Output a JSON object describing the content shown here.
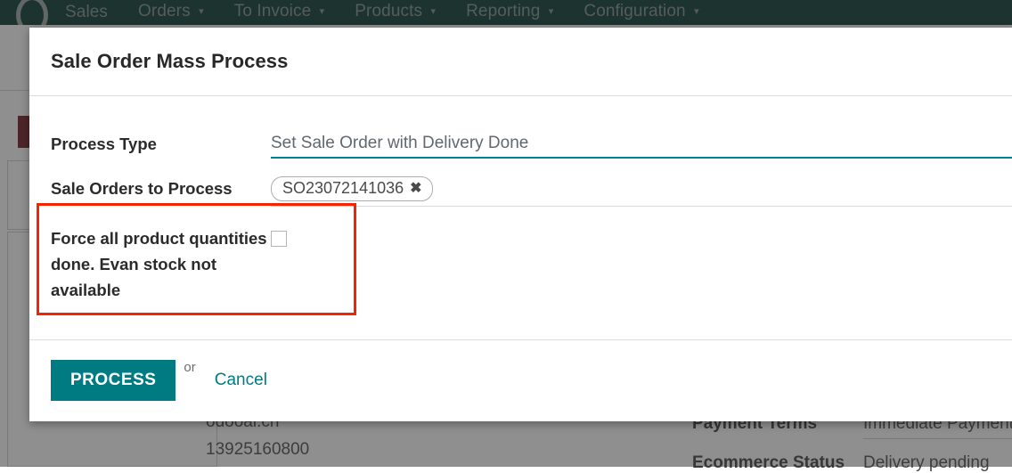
{
  "navbar": {
    "logo_icon": "odoo-o-logo-icon",
    "menu_items": [
      {
        "label": "Sales",
        "has_caret": false
      },
      {
        "label": "Orders",
        "has_caret": true
      },
      {
        "label": "To Invoice",
        "has_caret": true
      },
      {
        "label": "Products",
        "has_caret": true
      },
      {
        "label": "Reporting",
        "has_caret": true
      },
      {
        "label": "Configuration",
        "has_caret": true
      }
    ],
    "caret_glyph": "▾",
    "background_color": "#00342c"
  },
  "background_form": {
    "email": "odooai.cn",
    "phone": "13925160800",
    "payment_terms_label": "Payment Terms",
    "payment_terms_value": "Immediate Payment",
    "ecommerce_status_label": "Ecommerce Status",
    "ecommerce_status_value": "Delivery pending",
    "ribbon_color": "#6b1620"
  },
  "modal": {
    "title": "Sale Order Mass Process",
    "fields": {
      "process_type": {
        "label": "Process Type",
        "value": "Set Sale Order with Delivery Done",
        "underline_color": "#00838c"
      },
      "sale_orders": {
        "label": "Sale Orders to Process",
        "tags": [
          {
            "text": "SO23072141036",
            "remove_glyph": "✖"
          }
        ]
      },
      "force_done": {
        "label": "Force all product quantities done. Evan stock not available",
        "checked": false
      }
    },
    "footer": {
      "process_label": "PROCESS",
      "or_label": "or",
      "cancel_label": "Cancel",
      "process_color": "#017b82",
      "cancel_color": "#017b82"
    }
  },
  "annotation": {
    "color": "#f42300"
  }
}
